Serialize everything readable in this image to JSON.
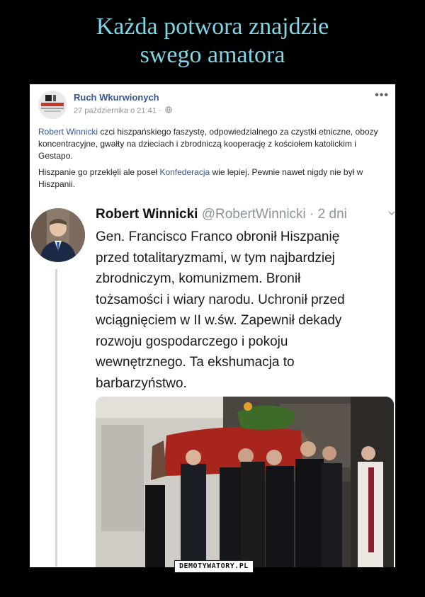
{
  "meme": {
    "title_line1": "Każda potwora znajdzie",
    "title_line2": "swego amatora",
    "watermark": "DEMOTYWATORY.PL"
  },
  "post": {
    "page_name": "Ruch Wkurwionych",
    "date": "27 października o 21:41 ·",
    "avatar_text": "RUCH WKURWIONYCH",
    "more_icon": "more-dots-icon",
    "paragraph1_link": "Robert Winnicki",
    "paragraph1_rest": " czci hiszpańskiego faszystę, odpowiedzialnego za czystki etniczne, obozy koncentracyjne, gwałty na dzieciach i zbrodniczą kooperację z kościołem katolickim i Gestapo.",
    "paragraph2_start": "Hiszpanie go przeklęli ale poseł ",
    "paragraph2_link": "Konfederacja",
    "paragraph2_end": " wie lepiej. Pewnie nawet nigdy nie był w Hiszpanii."
  },
  "tweet": {
    "name": "Robert Winnicki",
    "handle_time": " @RobertWinnicki · 2 dni",
    "lines": [
      "Gen. Francisco Franco obronił Hiszpanię",
      "przed totalitaryzmami, w tym najbardziej",
      "zbrodniczym, komunizmem. Bronił",
      "tożsamości i wiary narodu. Uchronił przed",
      "wciągnięciem w II w.św. Zapewnił dekady",
      "rozwoju gospodarczego i pokoju",
      "wewnętrznego. Ta ekshumacja to",
      "barbarzyństwo."
    ]
  },
  "colors": {
    "title": "#7fd7e8",
    "link": "#365899",
    "background": "#000000"
  }
}
